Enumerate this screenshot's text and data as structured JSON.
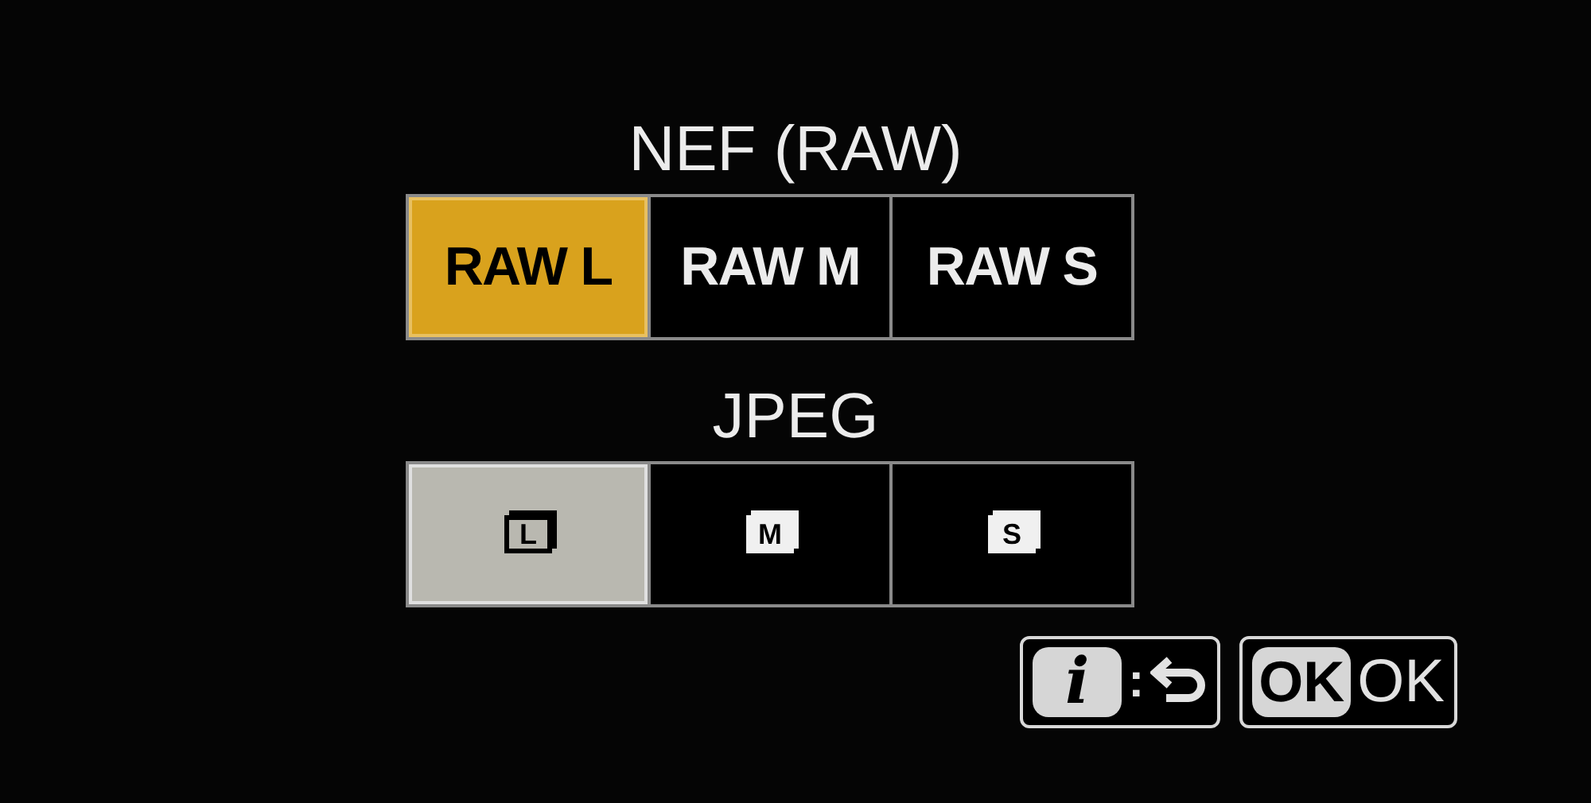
{
  "nef": {
    "title": "NEF (RAW)",
    "options": [
      {
        "label": "RAW L",
        "selected": true
      },
      {
        "label": "RAW M",
        "selected": false
      },
      {
        "label": "RAW S",
        "selected": false
      }
    ]
  },
  "jpeg": {
    "title": "JPEG",
    "options": [
      {
        "label": "L",
        "selected": true
      },
      {
        "label": "M",
        "selected": false
      },
      {
        "label": "S",
        "selected": false
      }
    ]
  },
  "footer": [
    {
      "kind": "info-back",
      "key": "i",
      "separator": ":"
    },
    {
      "kind": "ok",
      "key": "OK",
      "label": "OK"
    }
  ]
}
